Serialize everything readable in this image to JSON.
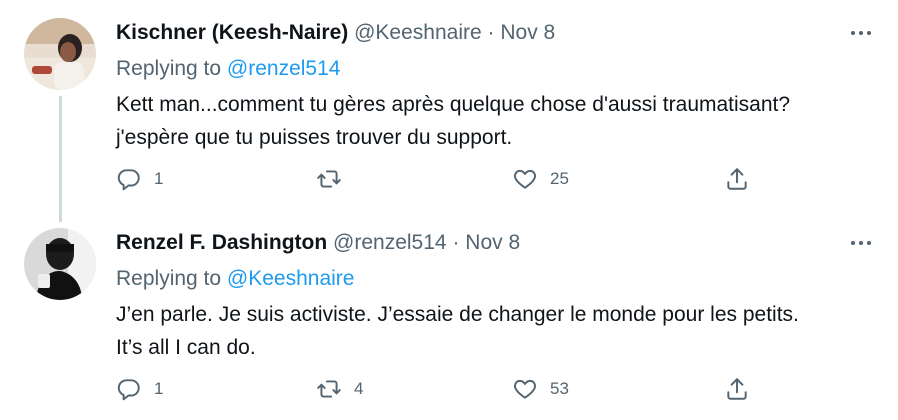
{
  "tweets": [
    {
      "name": "Kischner (Keesh-Naire)",
      "handle": "@Keeshnaire",
      "separator": "·",
      "date": "Nov 8",
      "replying_label": "Replying to",
      "replying_to": "@renzel514",
      "text_lines": [
        "Kett man...comment tu gères après quelque chose d'aussi traumatisant?",
        "j'espère que tu puisses trouver du support."
      ],
      "reply_count": "1",
      "retweet_count": "",
      "like_count": "25"
    },
    {
      "name": "Renzel F. Dashington",
      "handle": "@renzel514",
      "separator": "·",
      "date": "Nov 8",
      "replying_label": "Replying to",
      "replying_to": "@Keeshnaire",
      "text_lines": [
        "J’en parle. Je suis activiste. J’essaie de changer le monde pour les petits.",
        "It’s all I can do."
      ],
      "reply_count": "1",
      "retweet_count": "4",
      "like_count": "53"
    }
  ],
  "icons": {
    "more": "more-horizontal-icon",
    "reply": "speech-bubble-icon",
    "retweet": "retweet-arrows-icon",
    "like": "heart-icon",
    "share": "share-upload-icon"
  },
  "colors": {
    "primary_text": "#0f1419",
    "secondary_text": "#536471",
    "link": "#1d9bf0",
    "thread_line": "#cfd9de"
  }
}
